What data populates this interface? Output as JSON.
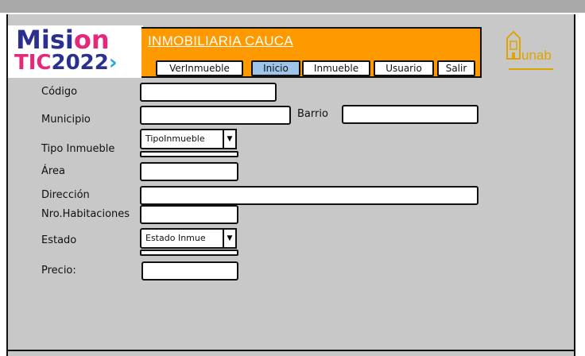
{
  "logo": {
    "line1_a": "Misi",
    "line1_b": "on",
    "line2_a": "TIC",
    "line2_b": "2022",
    "line2_c": "›"
  },
  "banner": {
    "title": "INMOBILIARIA CAUCA"
  },
  "nav": {
    "items": [
      {
        "label": "VerInmueble"
      },
      {
        "label": "Inicio"
      },
      {
        "label": "Inmueble"
      },
      {
        "label": "Usuario"
      },
      {
        "label": "Salir"
      }
    ],
    "active": "Inicio"
  },
  "partner_logo": {
    "text": "unab"
  },
  "form": {
    "codigo": {
      "label": "Código",
      "value": ""
    },
    "municipio": {
      "label": "Municipio",
      "value": ""
    },
    "barrio": {
      "label": "Barrio",
      "value": ""
    },
    "tipo_inmueble": {
      "label": "Tipo Inmueble",
      "selected": "TipoInmueble"
    },
    "area": {
      "label": "Área",
      "value": ""
    },
    "direccion": {
      "label": "Dirección",
      "value": ""
    },
    "nro_habitaciones": {
      "label": "Nro.Habitaciones",
      "value": ""
    },
    "estado": {
      "label": "Estado",
      "selected": "Estado Inmue"
    },
    "precio": {
      "label": "Precio:",
      "value": ""
    }
  },
  "colors": {
    "banner": "#ff9900",
    "active_tab": "#9fc4ea",
    "background": "#c8c8c8",
    "logo_blue": "#2b2f8f",
    "logo_pink": "#e6287a"
  },
  "icons": {
    "dropdown": "chevron-down-icon",
    "partner": "unab-building-icon"
  }
}
